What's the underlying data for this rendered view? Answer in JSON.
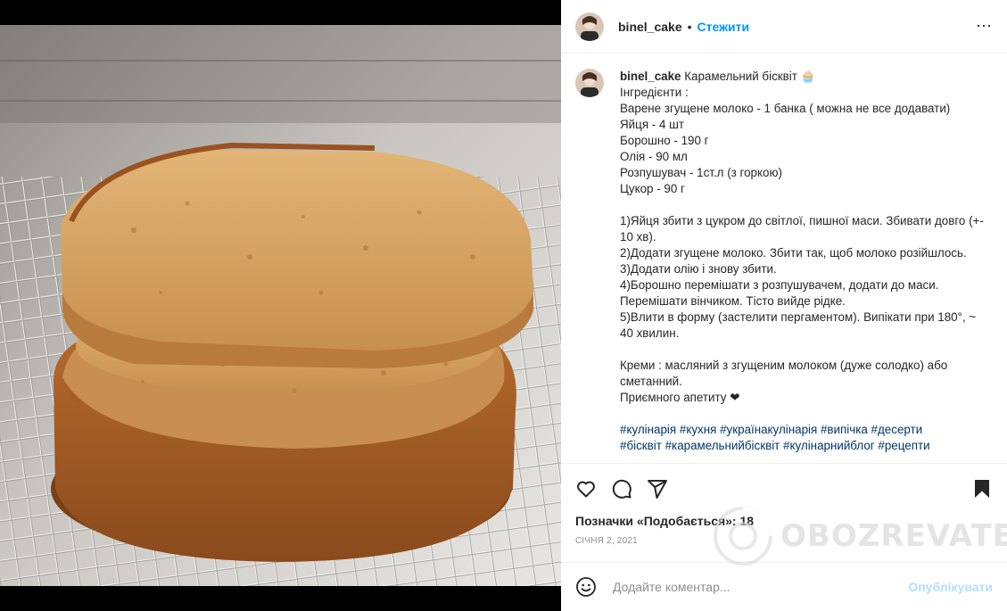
{
  "post": {
    "username": "binel_cake",
    "follow_label": "Стежити",
    "separator": "•",
    "more_icon": "⋯"
  },
  "caption": {
    "username": "binel_cake",
    "title": "Карамельний бісквіт 🧁",
    "lines": [
      "Інгредієнти :",
      "Варене згущене молоко - 1 банка ( можна не все додавати)",
      "Яйця - 4 шт",
      "Борошно - 190 г",
      "Олія - 90 мл",
      "Розпушувач - 1ст.л (з горкою)",
      "Цукор - 90 г"
    ],
    "steps": [
      "1)Яйця збити з цукром до світлої, пишної маси. Збивати довго (+- 10 хв).",
      "2)Додати згущене молоко. Збити так, щоб молоко розійшлось.",
      "3)Додати олію і знову збити.",
      "4)Борошно перемішати з розпушувачем, додати до маси. Перемішати вінчиком. Тісто вийде рідке.",
      "5)Влити в форму (застелити пергаментом). Випікати при 180°, ~ 40 хвилин."
    ],
    "cream": "Креми : масляний з згущеним молоком (дуже солодко) або сметанний.",
    "closing": "Приємного апетиту ❤",
    "hashtags": "#кулінарія #кухня #українакулінарія #випічка #десерти",
    "hashtags_cut": "#бісквіт #карамельнийбісквіт #кулінарнийблог #рецепти"
  },
  "actions": {
    "like_icon": "heart-icon",
    "comment_icon": "comment-icon",
    "share_icon": "share-icon",
    "save_icon": "bookmark-icon"
  },
  "likes": {
    "label": "Позначки «Подобається»:",
    "count": "18"
  },
  "date": "СІЧНЯ 2, 2021",
  "comment_box": {
    "placeholder": "Додайте коментар...",
    "publish_label": "Опублікувати"
  },
  "watermark": {
    "text": "OBOZREVATEL"
  },
  "colors": {
    "link": "#0095f6",
    "publish_disabled": "#b2dffc",
    "hashtag": "#00376b"
  }
}
